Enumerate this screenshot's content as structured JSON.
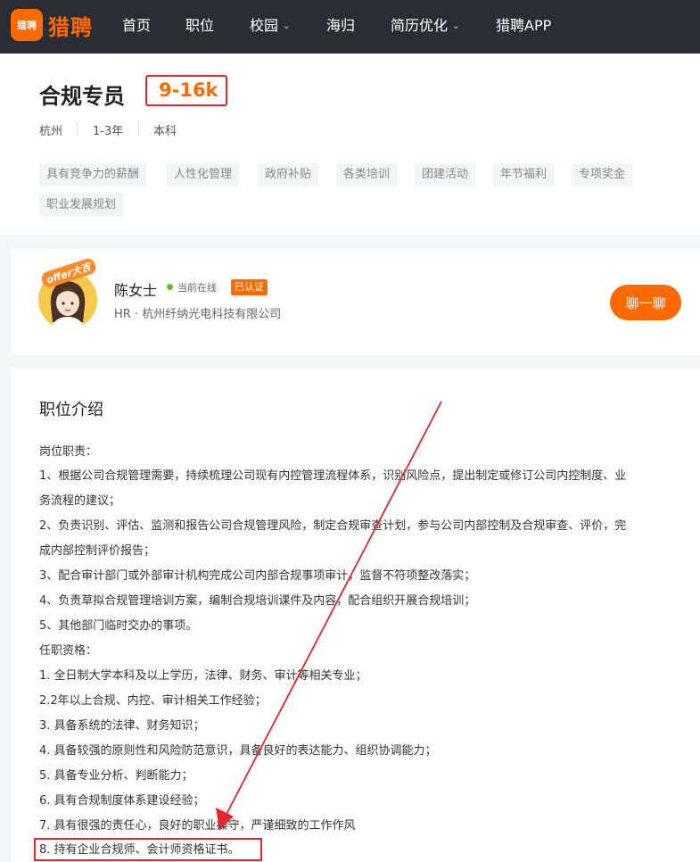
{
  "nav": {
    "logo_badge": "猎聘",
    "logo_text": "猎聘",
    "items": [
      {
        "label": "首页"
      },
      {
        "label": "职位"
      },
      {
        "label": "校园"
      },
      {
        "label": "海归"
      },
      {
        "label": "简历优化"
      },
      {
        "label": "猎聘APP"
      }
    ]
  },
  "job": {
    "title": "合规专员",
    "salary": "9-16k",
    "meta": [
      "杭州",
      "1-3年",
      "本科"
    ],
    "tags": [
      "具有竞争力的薪酬",
      "人性化管理",
      "政府补贴",
      "各类培训",
      "团建活动",
      "年节福利",
      "专项奖金",
      "职业发展规划"
    ]
  },
  "recruiter": {
    "avatar_badge": "offer大吉",
    "name": "陈女士",
    "status": "当前在线",
    "verified": "已认证",
    "company": "HR · 杭州纤纳光电科技有限公司",
    "chat_label": "聊一聊"
  },
  "description": {
    "title": "职位介绍",
    "lines": [
      "岗位职责：",
      "1、根据公司合规管理需要，持续梳理公司现有内控管理流程体系，识别风险点，提出制定或修订公司内控制度、业",
      "务流程的建议；",
      "2、负责识别、评估、监测和报告公司合规管理风险，制定合规审查计划，参与公司内部控制及合规审查、评价，完",
      "成内部控制评价报告；",
      "3、配合审计部门或外部审计机构完成公司内部合规事项审计，监督不符项整改落实；",
      "4、负责草拟合规管理培训方案，编制合规培训课件及内容，配合组织开展合规培训；",
      "5、其他部门临时交办的事项。",
      "任职资格：",
      "1. 全日制大学本科及以上学历，法律、财务、审计等相关专业；",
      "2.2年以上合规、内控、审计相关工作经验；",
      "3. 具备系统的法律、财务知识；",
      "4. 具备较强的原则性和风险防范意识，具备良好的表达能力、组织协调能力；",
      "5. 具备专业分析、判断能力；",
      "6. 具有合规制度体系建设经验；",
      "7. 具有很强的责任心，良好的职业操守，严谨细致的工作作风",
      "8. 持有企业合规师、会计师资格证书。"
    ]
  },
  "colors": {
    "accent": "#ff6a00",
    "nav_bg": "#2a2d33",
    "annotation_red": "#e5262c",
    "online_green": "#52c41a"
  }
}
